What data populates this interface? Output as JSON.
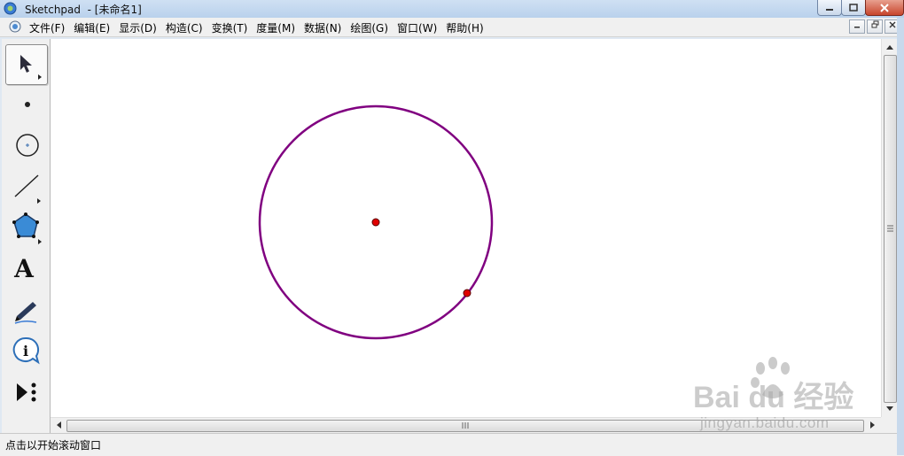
{
  "window": {
    "title": "Sketchpad  - [未命名1]"
  },
  "menubar": {
    "items": [
      {
        "label": "文件(F)"
      },
      {
        "label": "编辑(E)"
      },
      {
        "label": "显示(D)"
      },
      {
        "label": "构造(C)"
      },
      {
        "label": "变换(T)"
      },
      {
        "label": "度量(M)"
      },
      {
        "label": "数据(N)"
      },
      {
        "label": "绘图(G)"
      },
      {
        "label": "窗口(W)"
      },
      {
        "label": "帮助(H)"
      }
    ]
  },
  "toolbox": {
    "tools": [
      {
        "icon": "arrow-select-icon",
        "selected": true
      },
      {
        "icon": "point-tool-icon"
      },
      {
        "icon": "compass-circle-icon"
      },
      {
        "icon": "straightedge-icon"
      },
      {
        "icon": "polygon-icon"
      },
      {
        "icon": "text-tool-icon",
        "glyph": "A"
      },
      {
        "icon": "marker-icon"
      },
      {
        "icon": "information-icon",
        "glyph": "i"
      },
      {
        "icon": "custom-tool-icon"
      }
    ]
  },
  "canvas": {
    "circle_color": "#800080",
    "point_color": "#e00000"
  },
  "statusbar": {
    "text": "点击以开始滚动窗口"
  },
  "watermark": {
    "brand": "Bai du 经验",
    "url": "jingyan.baidu.com"
  }
}
